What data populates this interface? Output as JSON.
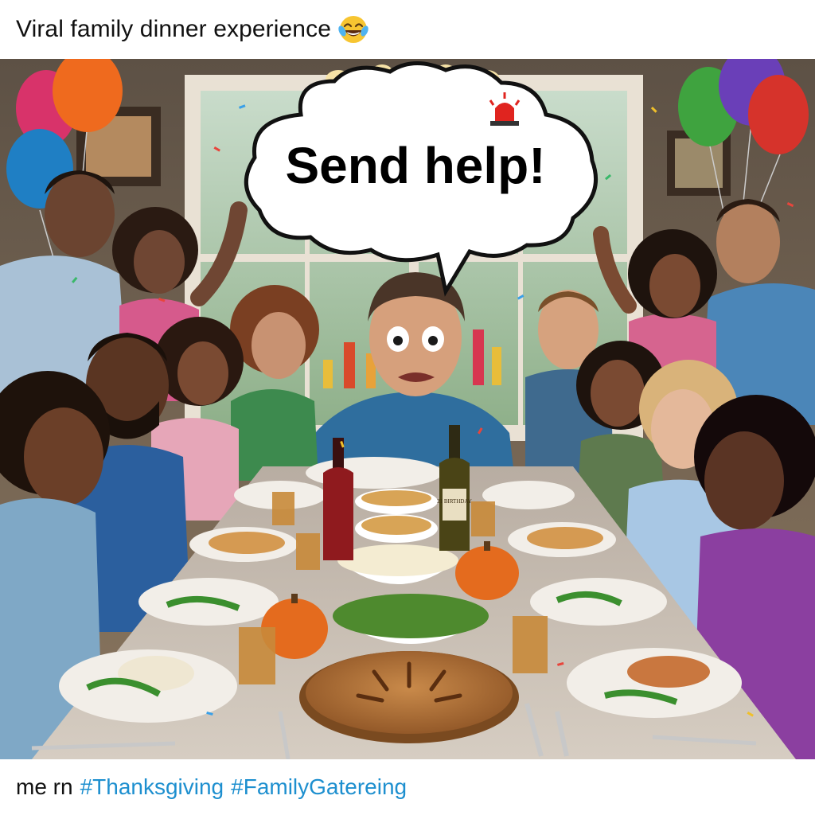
{
  "post": {
    "title": "Viral family dinner experience",
    "title_emoji": "face-with-tears-of-joy-icon",
    "caption_text": "me rn",
    "hashtags": [
      "#Thanksgiving",
      "#FamilyGatereing"
    ],
    "colors": {
      "hashtag": "#1d8fcf",
      "text": "#111111",
      "background": "#ffffff"
    }
  },
  "image": {
    "speech_bubble_text": "Send help!",
    "bottle_label": "21 BIRTHDAY",
    "siren_icon": "police-siren-icon"
  }
}
